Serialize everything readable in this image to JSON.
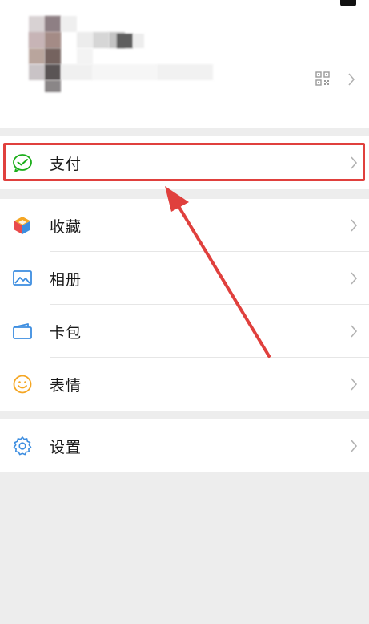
{
  "menu": {
    "pay": {
      "label": "支付",
      "icon": "wechat-pay-icon",
      "accent": "#1aad19"
    },
    "items": [
      {
        "label": "收藏",
        "icon": "favorites-cube-icon"
      },
      {
        "label": "相册",
        "icon": "album-picture-icon"
      },
      {
        "label": "卡包",
        "icon": "card-wallet-icon"
      },
      {
        "label": "表情",
        "icon": "sticker-smiley-icon"
      }
    ],
    "settings": {
      "label": "设置",
      "icon": "settings-gear-icon"
    }
  },
  "annotation": {
    "color": "#e0403d"
  },
  "colors": {
    "background": "#ededed",
    "surface": "#ffffff",
    "icon_blue": "#3c8de0"
  }
}
